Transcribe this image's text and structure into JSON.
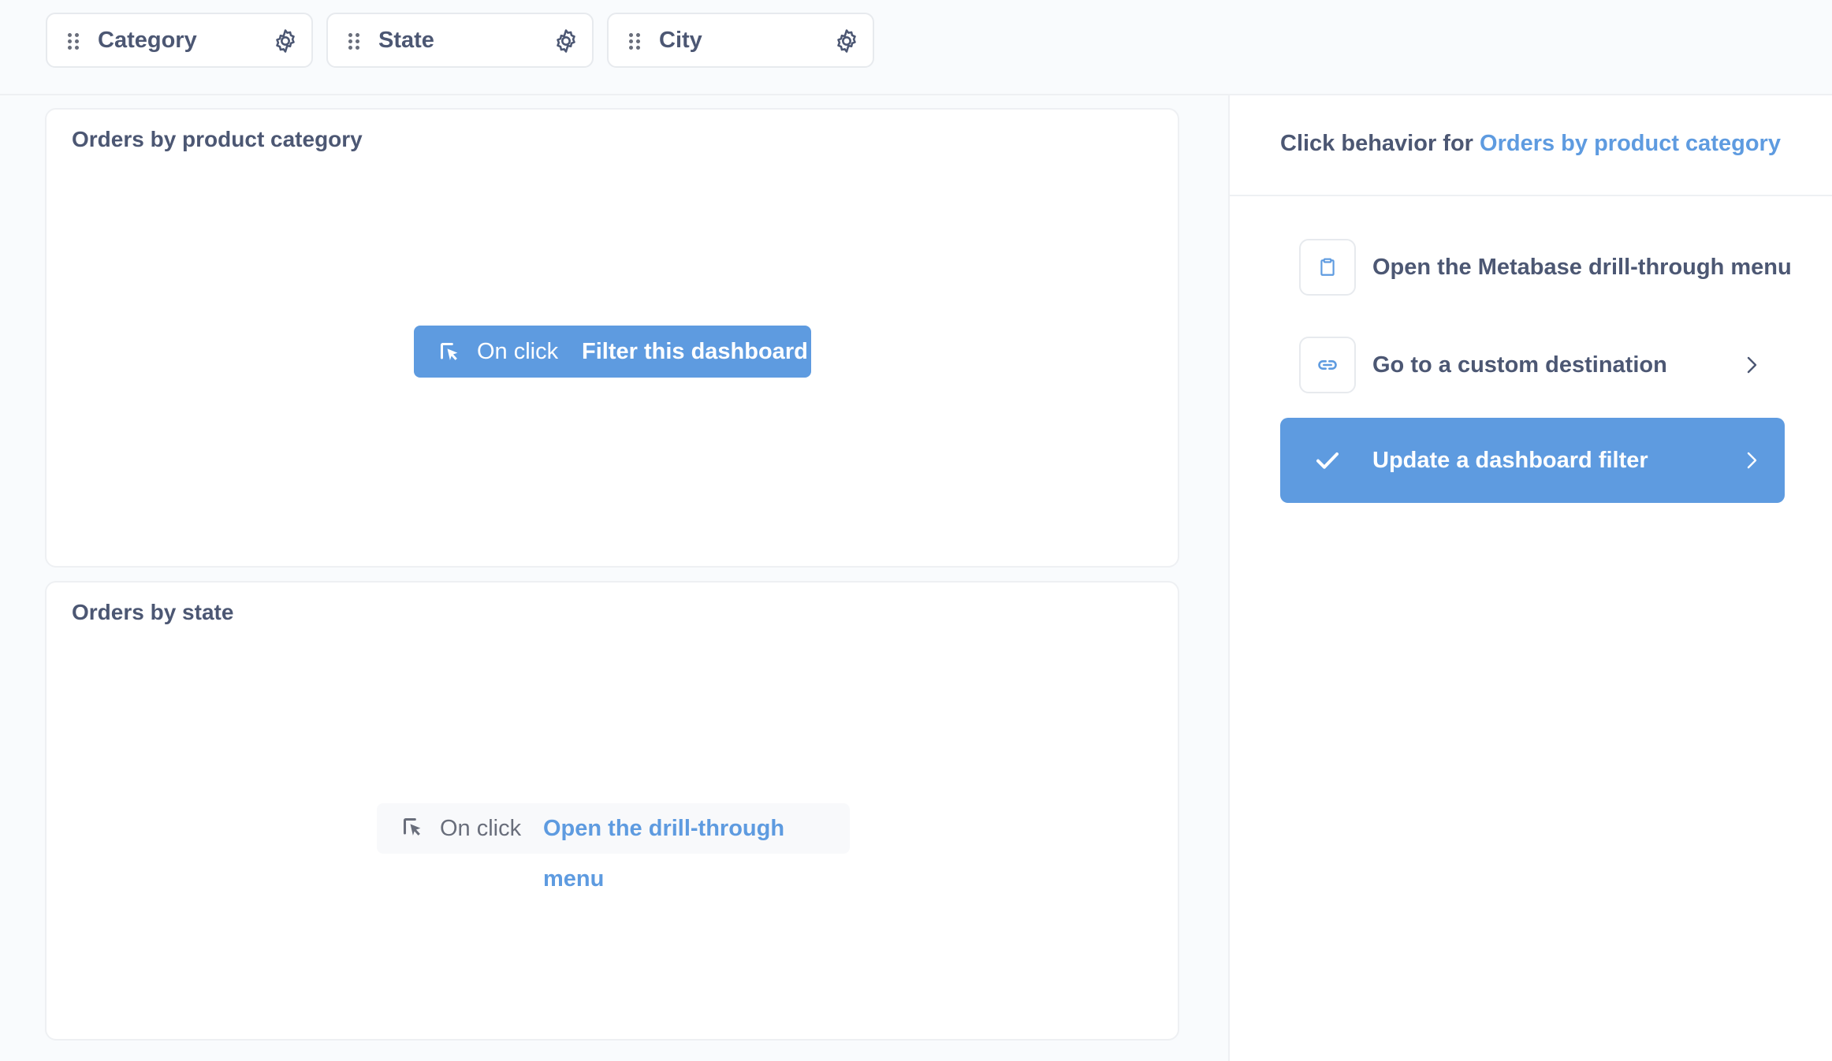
{
  "filters": [
    {
      "label": "Category"
    },
    {
      "label": "State"
    },
    {
      "label": "City"
    }
  ],
  "cards": [
    {
      "title": "Orders by product category",
      "on_click_label": "On click",
      "on_click_action": "Filter this dashboard"
    },
    {
      "title": "Orders by state",
      "on_click_label": "On click",
      "on_click_action": "Open the drill-through menu"
    }
  ],
  "sidebar": {
    "title_prefix": "Click behavior for ",
    "title_link": "Orders by product category",
    "options": [
      {
        "label": "Open the Metabase drill-through menu",
        "icon": "clipboard-icon"
      },
      {
        "label": "Go to a custom destination",
        "icon": "link-icon"
      },
      {
        "label": "Update a dashboard filter",
        "icon": "check-icon"
      }
    ]
  },
  "colors": {
    "brand": "#5e9be0",
    "text": "#4c5773",
    "border": "#eef0f3",
    "background": "#f9fbfd"
  }
}
